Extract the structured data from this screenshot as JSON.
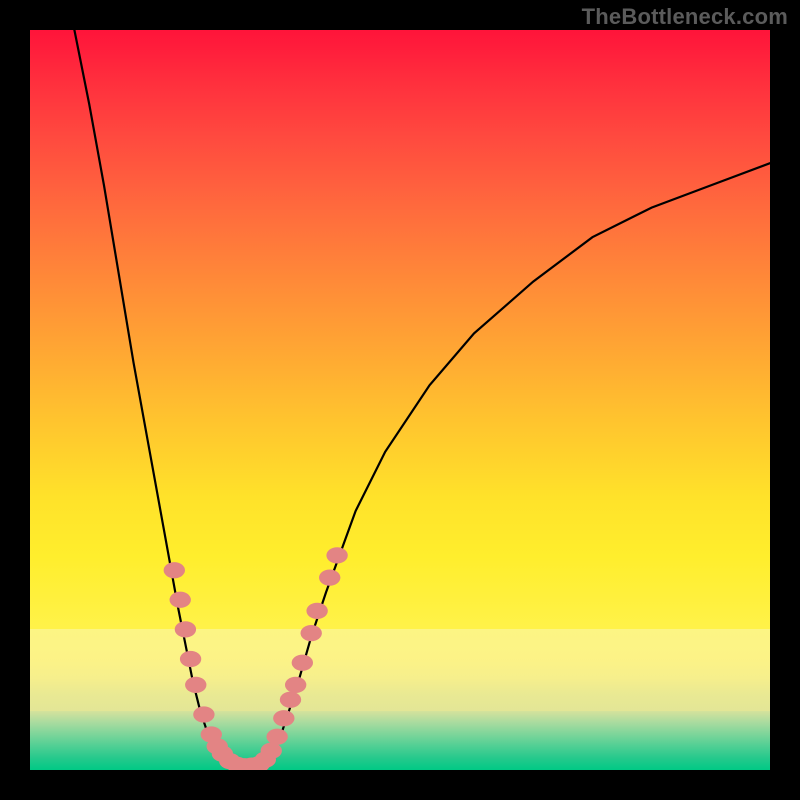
{
  "watermark": "TheBottleneck.com",
  "colors": {
    "gradient_top": "#ff143a",
    "gradient_mid": "#ffe22a",
    "gradient_low": "#fcf584",
    "gradient_green": "#00c985",
    "curve": "#000000",
    "markers": "#e38484",
    "frame": "#000000"
  },
  "chart_data": {
    "type": "line",
    "title": "",
    "xlabel": "",
    "ylabel": "",
    "xlim": [
      0,
      100
    ],
    "ylim": [
      0,
      100
    ],
    "grid": false,
    "legend": false,
    "series": [
      {
        "name": "left-branch",
        "x": [
          6,
          8,
          10,
          12,
          14,
          16,
          18,
          20,
          21,
          22,
          23,
          24,
          25,
          26,
          27
        ],
        "y": [
          100,
          90,
          79,
          67,
          55,
          44,
          33,
          22,
          17,
          12,
          8,
          5,
          3,
          1.5,
          0.5
        ]
      },
      {
        "name": "valley-floor",
        "x": [
          27,
          28,
          29,
          30,
          31,
          32
        ],
        "y": [
          0.5,
          0.3,
          0.2,
          0.3,
          0.5,
          0.8
        ]
      },
      {
        "name": "right-branch",
        "x": [
          32,
          34,
          36,
          38,
          40,
          44,
          48,
          54,
          60,
          68,
          76,
          84,
          92,
          100
        ],
        "y": [
          0.8,
          5,
          11,
          18,
          24,
          35,
          43,
          52,
          59,
          66,
          72,
          76,
          79,
          82
        ]
      }
    ],
    "markers": [
      {
        "x": 19.5,
        "y": 27,
        "r": 1.1
      },
      {
        "x": 20.3,
        "y": 23,
        "r": 1.1
      },
      {
        "x": 21.0,
        "y": 19,
        "r": 1.1
      },
      {
        "x": 21.7,
        "y": 15,
        "r": 1.1
      },
      {
        "x": 22.4,
        "y": 11.5,
        "r": 1.1
      },
      {
        "x": 23.5,
        "y": 7.5,
        "r": 1.1
      },
      {
        "x": 24.5,
        "y": 4.8,
        "r": 1.1
      },
      {
        "x": 25.3,
        "y": 3.2,
        "r": 1.1
      },
      {
        "x": 26.0,
        "y": 2.2,
        "r": 1.1
      },
      {
        "x": 27.0,
        "y": 1.2,
        "r": 1.1
      },
      {
        "x": 28.0,
        "y": 0.7,
        "r": 1.1
      },
      {
        "x": 29.0,
        "y": 0.5,
        "r": 1.1
      },
      {
        "x": 30.0,
        "y": 0.6,
        "r": 1.1
      },
      {
        "x": 31.0,
        "y": 0.8,
        "r": 1.1
      },
      {
        "x": 31.8,
        "y": 1.4,
        "r": 1.1
      },
      {
        "x": 32.6,
        "y": 2.6,
        "r": 1.1
      },
      {
        "x": 33.4,
        "y": 4.5,
        "r": 1.1
      },
      {
        "x": 34.3,
        "y": 7.0,
        "r": 1.1
      },
      {
        "x": 35.2,
        "y": 9.5,
        "r": 1.1
      },
      {
        "x": 35.9,
        "y": 11.5,
        "r": 1.1
      },
      {
        "x": 36.8,
        "y": 14.5,
        "r": 1.1
      },
      {
        "x": 38.0,
        "y": 18.5,
        "r": 1.1
      },
      {
        "x": 38.8,
        "y": 21.5,
        "r": 1.1
      },
      {
        "x": 40.5,
        "y": 26.0,
        "r": 1.1
      },
      {
        "x": 41.5,
        "y": 29.0,
        "r": 1.1
      }
    ],
    "background_bands": [
      {
        "name": "red-yellow-gradient",
        "from_y": 19,
        "to_y": 100
      },
      {
        "name": "pale-yellow",
        "from_y": 8,
        "to_y": 19
      },
      {
        "name": "green-gradient",
        "from_y": 0,
        "to_y": 8
      }
    ]
  }
}
